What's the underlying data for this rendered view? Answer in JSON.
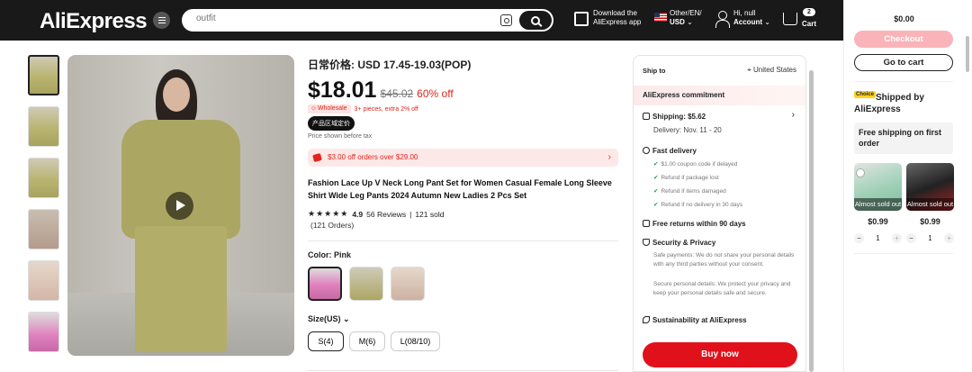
{
  "header": {
    "logo": "AliExpress",
    "search_placeholder": "outfit",
    "app_line1": "Download the",
    "app_line2": "AliExpress app",
    "locale_line1": "Other/EN/",
    "locale_line2": "USD",
    "account_line1": "Hi, null",
    "account_line2": "Account",
    "cart_count": "2",
    "cart_label": "Cart"
  },
  "product": {
    "reference_price": "日常价格: USD 17.45-19.03(POP)",
    "price_now": "$18.01",
    "price_old": "$45.02",
    "discount": "60% off",
    "wholesale_badge": "Wholesale",
    "wholesale_text": "3+ pieces, extra 2% off",
    "origin_badge": "产品区域定价",
    "tax_note": "Price shown before tax",
    "coupon": "$3.00 off orders over $29.00",
    "name": "Fashion Lace Up V Neck Long Pant Set for Women Casual Female Long Sleeve Shirt Wide Leg Pants 2024 Autumn New Ladies 2 Pcs Set",
    "stars": "★★★★★",
    "rating": "4.9",
    "reviews": "56 Reviews",
    "sold": "121 sold",
    "orders": "(121 Orders)",
    "color_label": "Color: Pink",
    "size_label": "Size(US)",
    "sizes": [
      "S(4)",
      "M(6)",
      "L(08/10)"
    ]
  },
  "shipping": {
    "ship_to_label": "Ship to",
    "ship_to_value": "United States",
    "commitment": "AliExpress commitment",
    "shipping_cost": "Shipping: $5.62",
    "delivery": "Delivery: Nov. 11 - 20",
    "fast_delivery": "Fast delivery",
    "fast_items": [
      "$1.00 coupon code if delayed",
      "Refund if package lost",
      "Refund if items damaged",
      "Refund if no delivery in 30 days"
    ],
    "free_returns": "Free returns within 90 days",
    "security": "Security & Privacy",
    "security_text1": "Safe payments: We do not share your personal details with any third parties without your consent.",
    "security_text2": "Secure personal details: We protect your privacy and keep your personal details safe and secure.",
    "sustainability": "Sustainability at AliExpress",
    "buy_now": "Buy now"
  },
  "side_cart": {
    "total": "$0.00",
    "checkout": "Checkout",
    "go_to_cart": "Go to cart",
    "choice_badge": "Choice",
    "shipped_by": "Shipped by AliExpress",
    "free_shipping": "Free shipping on first order",
    "items": [
      {
        "status": "Almost sold out",
        "price": "$0.99",
        "qty": "1"
      },
      {
        "status": "Almost sold out",
        "price": "$0.99",
        "qty": "1"
      }
    ]
  },
  "colors": {
    "accent": "#e1251b",
    "topbar": "#191919",
    "buy": "#e1111b",
    "checkout": "#f9b4b9"
  }
}
